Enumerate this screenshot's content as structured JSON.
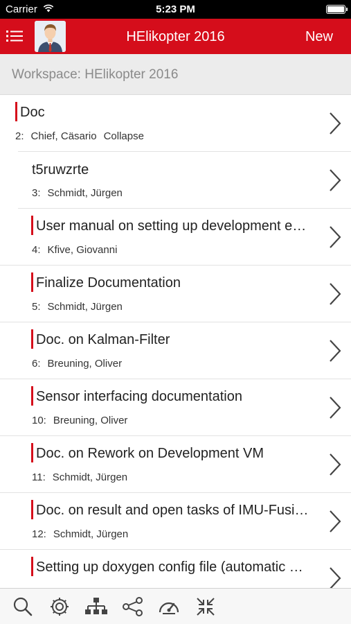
{
  "status_bar": {
    "carrier": "Carrier",
    "time": "5:23 PM"
  },
  "nav": {
    "title": "HElikopter 2016",
    "new_label": "New",
    "icons": [
      "menu-icon",
      "user-avatar"
    ]
  },
  "workspace": {
    "label": "Workspace: HElikopter 2016"
  },
  "items": [
    {
      "title": "Doc",
      "number": "2:",
      "person": "Chief, Cäsario",
      "extra": "Collapse",
      "level": 0,
      "marked": true
    },
    {
      "title": "t5ruwzrte",
      "number": "3:",
      "person": "Schmidt, Jürgen",
      "extra": "",
      "level": 1,
      "marked": false
    },
    {
      "title": "User manual on setting up development e…",
      "number": "4:",
      "person": "Kfive, Giovanni",
      "extra": "",
      "level": 1,
      "marked": true
    },
    {
      "title": "Finalize Documentation",
      "number": "5:",
      "person": "Schmidt, Jürgen",
      "extra": "",
      "level": 1,
      "marked": true
    },
    {
      "title": "Doc. on Kalman-Filter",
      "number": "6:",
      "person": "Breuning, Oliver",
      "extra": "",
      "level": 1,
      "marked": true
    },
    {
      "title": "Sensor interfacing documentation",
      "number": "10:",
      "person": "Breuning, Oliver",
      "extra": "",
      "level": 1,
      "marked": true
    },
    {
      "title": "Doc. on Rework on Development VM",
      "number": "11:",
      "person": "Schmidt, Jürgen",
      "extra": "",
      "level": 1,
      "marked": true
    },
    {
      "title": "Doc. on result and open tasks of IMU-Fusi…",
      "number": "12:",
      "person": "Schmidt, Jürgen",
      "extra": "",
      "level": 1,
      "marked": true
    },
    {
      "title": "Setting up doxygen config file (automatic …",
      "number": "",
      "person": "",
      "extra": "",
      "level": 1,
      "marked": true
    }
  ],
  "tabbar": {
    "icons": [
      "search-icon",
      "settings-icon",
      "hierarchy-icon",
      "workflow-icon",
      "dashboard-icon",
      "collapse-icon"
    ]
  },
  "colors": {
    "accent": "#d50d1b",
    "workspace_bg": "#ececec",
    "icon_gray": "#444444"
  }
}
